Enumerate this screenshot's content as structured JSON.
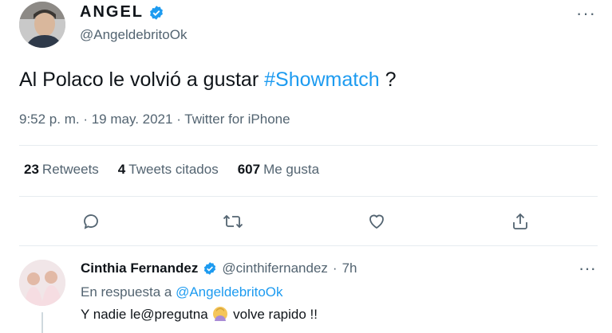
{
  "author": {
    "name": "ANGEL",
    "handle": "@AngeldebritoOk",
    "verified": true
  },
  "tweet": {
    "text_before": "Al Polaco le volvió a gustar ",
    "hashtag": "#Showmatch",
    "text_after": " ?",
    "time": "9:52 p. m.",
    "date": "19 may. 2021",
    "source": "Twitter for iPhone",
    "separator": " · "
  },
  "stats": {
    "retweets_count": "23",
    "retweets_label": "Retweets",
    "quotes_count": "4",
    "quotes_label": "Tweets citados",
    "likes_count": "607",
    "likes_label": "Me gusta"
  },
  "actions": [
    "reply-icon",
    "retweet-icon",
    "like-icon",
    "share-icon"
  ],
  "reply": {
    "name": "Cinthia Fernandez",
    "verified": true,
    "handle": "@cinthifernandez",
    "time": "7h",
    "separator": " · ",
    "in_reply_prefix": "En respuesta a ",
    "in_reply_handle": "@AngeldebritoOk",
    "text_before": "Y nadie le@pregutna ",
    "text_after": " volve rapido !!"
  },
  "more_label": "···",
  "colors": {
    "accent": "#1d9bf0",
    "text": "#0f1419",
    "muted": "#536471",
    "divider": "#e6ecf0"
  }
}
